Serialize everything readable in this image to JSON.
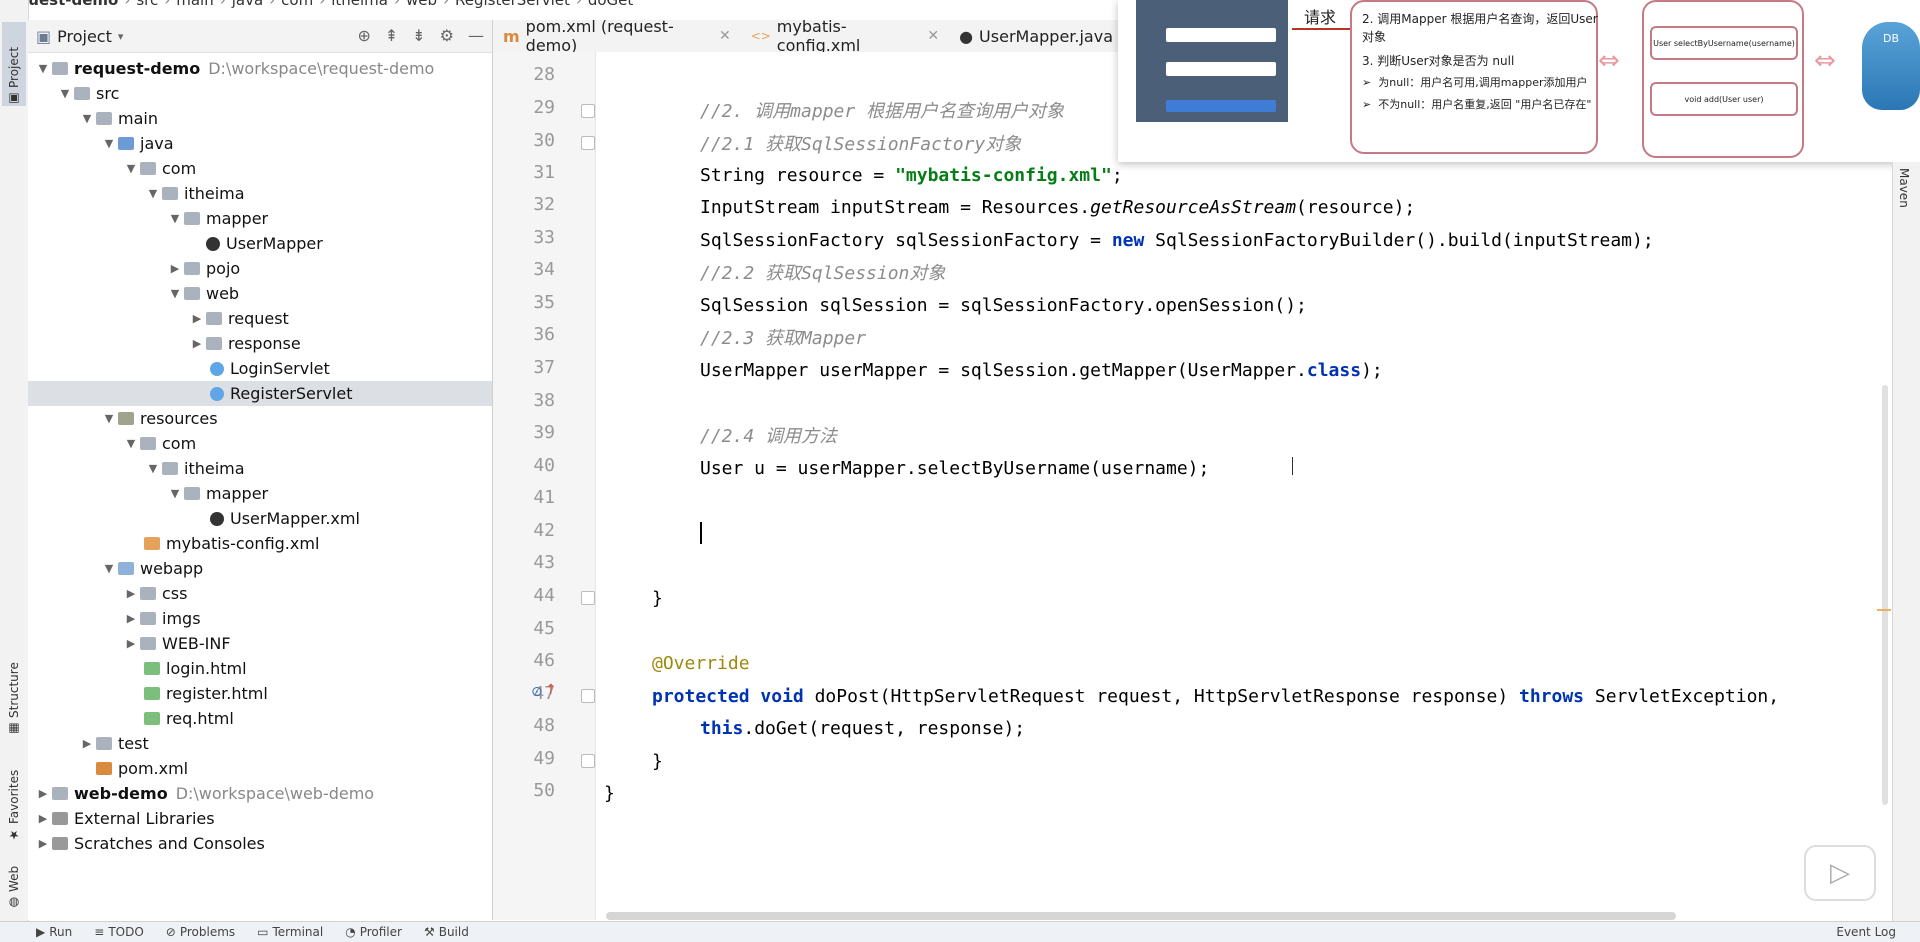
{
  "breadcrumb": [
    "request-demo",
    "src",
    "main",
    "java",
    "com",
    "itheima",
    "web",
    "RegisterServlet",
    "doGet"
  ],
  "left_tabs": {
    "project": "Project",
    "structure": "Structure",
    "favorites": "Favorites",
    "web": "Web"
  },
  "project_panel": {
    "title": "Project"
  },
  "tree": [
    {
      "label": "request-demo",
      "path": "D:\\workspace\\request-demo",
      "bold": true
    },
    {
      "label": "src"
    },
    {
      "label": "main"
    },
    {
      "label": "java"
    },
    {
      "label": "com"
    },
    {
      "label": "itheima"
    },
    {
      "label": "mapper"
    },
    {
      "label": "UserMapper"
    },
    {
      "label": "pojo"
    },
    {
      "label": "web"
    },
    {
      "label": "request"
    },
    {
      "label": "response"
    },
    {
      "label": "LoginServlet"
    },
    {
      "label": "RegisterServlet"
    },
    {
      "label": "resources"
    },
    {
      "label": "com"
    },
    {
      "label": "itheima"
    },
    {
      "label": "mapper"
    },
    {
      "label": "UserMapper.xml"
    },
    {
      "label": "mybatis-config.xml"
    },
    {
      "label": "webapp"
    },
    {
      "label": "css"
    },
    {
      "label": "imgs"
    },
    {
      "label": "WEB-INF"
    },
    {
      "label": "login.html"
    },
    {
      "label": "register.html"
    },
    {
      "label": "req.html"
    },
    {
      "label": "test"
    },
    {
      "label": "pom.xml"
    },
    {
      "label": "web-demo",
      "path": "D:\\workspace\\web-demo",
      "bold": true
    },
    {
      "label": "External Libraries"
    },
    {
      "label": "Scratches and Consoles"
    }
  ],
  "editor_tabs": [
    "pom.xml (request-demo)",
    "mybatis-config.xml",
    "UserMapper.java"
  ],
  "line_numbers": [
    "28",
    "29",
    "30",
    "31",
    "32",
    "33",
    "34",
    "35",
    "36",
    "37",
    "38",
    "39",
    "40",
    "41",
    "42",
    "43",
    "44",
    "45",
    "46",
    "47",
    "48",
    "49",
    "50"
  ],
  "code": {
    "l29": "//2. 调用mapper 根据用户名查询用户对象",
    "l30": "//2.1 获取SqlSessionFactory对象",
    "l31a": "String resource = ",
    "l31s": "\"mybatis-config.xml\"",
    "l31b": ";",
    "l32a": "InputStream inputStream = Resources.",
    "l32m": "getResourceAsStream",
    "l32b": "(resource);",
    "l33a": "SqlSessionFactory sqlSessionFactory = ",
    "l33k": "new",
    "l33b": " SqlSessionFactoryBuilder().build(inputStream);",
    "l34": "//2.2 获取SqlSession对象",
    "l35": "SqlSession sqlSession = sqlSessionFactory.openSession();",
    "l36": "//2.3 获取Mapper",
    "l37a": "UserMapper userMapper = sqlSession.getMapper(UserMapper.",
    "l37k": "class",
    "l37b": ");",
    "l39": "//2.4 调用方法",
    "l40": "User u = userMapper.selectByUsername(username);",
    "l44": "}",
    "l46": "@Override",
    "l47k1": "protected",
    "l47k2": "void",
    "l47a": " doPost(HttpServletRequest request, HttpServletResponse response) ",
    "l47k3": "throws",
    "l47b": " ServletException,",
    "l48k": "this",
    "l48b": ".doGet(request, response);",
    "l49": "}",
    "l50": "}"
  },
  "overlay": {
    "request_label": "请求",
    "step2": "2. 调用Mapper 根据用户名查询，返回User",
    "step2b": "对象",
    "step3": "3. 判断User对象是否为 null",
    "bullet1": "为null：用户名可用,调用mapper添加用户",
    "bullet2": "不为null：用户名重复,返回 \"用户名已存在\"",
    "method1": "User selectByUsername(username)",
    "method2": "void add(User user)",
    "db_label": "DB"
  },
  "right_strip": {
    "maven": "Maven"
  },
  "bottom_bar": {
    "run": "Run",
    "todo": "TODO",
    "problems": "Problems",
    "terminal": "Terminal",
    "profiler": "Profiler",
    "build": "Build",
    "event_log": "Event Log"
  }
}
